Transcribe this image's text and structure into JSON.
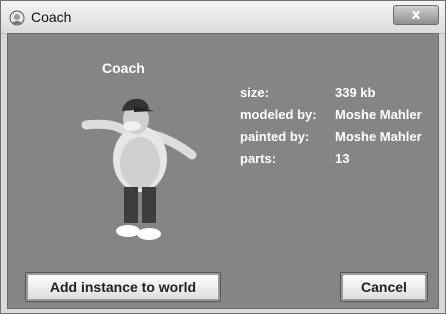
{
  "window": {
    "title": "Coach",
    "close_glyph": "x",
    "icon": "person-head-icon"
  },
  "model": {
    "name": "Coach",
    "image": "coach-3d-model"
  },
  "info": {
    "size_label": "size:",
    "size_value": "339 kb",
    "modeled_label": "modeled by:",
    "modeled_value": "Moshe Mahler",
    "painted_label": "painted by:",
    "painted_value": "Moshe Mahler",
    "parts_label": "parts:",
    "parts_value": "13"
  },
  "buttons": {
    "add_label": "Add instance to world",
    "cancel_label": "Cancel"
  },
  "colors": {
    "panel_background": "#858585",
    "text": "#ffffff"
  }
}
